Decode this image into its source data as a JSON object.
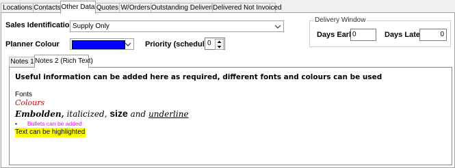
{
  "tabs": [
    {
      "label": "Locations"
    },
    {
      "label": "Contacts"
    },
    {
      "label": "Other Data"
    },
    {
      "label": "Quotes"
    },
    {
      "label": "W/Orders"
    },
    {
      "label": "Outstanding Deliveries"
    },
    {
      "label": "Delivered Not Invoiced"
    }
  ],
  "sales_identification": {
    "label": "Sales Identification",
    "value": "Supply Only"
  },
  "planner_colour": {
    "label": "Planner Colour",
    "color": "#0000ff"
  },
  "priority": {
    "label": "Priority (scheduler)",
    "value": "0"
  },
  "delivery_window": {
    "legend": "Delivery Window",
    "days_early_label": "Days Early",
    "days_early_value": "0",
    "days_late_label": "Days Late",
    "days_late_value": "0"
  },
  "notes_tabs": [
    {
      "label": "Notes 1"
    },
    {
      "label": "Notes 2 (Rich Text)"
    }
  ],
  "rich_text": {
    "heading": "Useful information can be added here as required, different fonts and colours can be used",
    "fonts": "Fonts",
    "colours": "Colours",
    "embolden": "Embolden,",
    "italicized": "italicized,",
    "size": "size",
    "and": "and",
    "underline": "underline",
    "bullet": "Bullets can be added",
    "highlight": "Text can be highlighted",
    "colours_color": "#e00000",
    "bullet_color": "#ff00ff",
    "highlight_color": "#ffff00"
  }
}
